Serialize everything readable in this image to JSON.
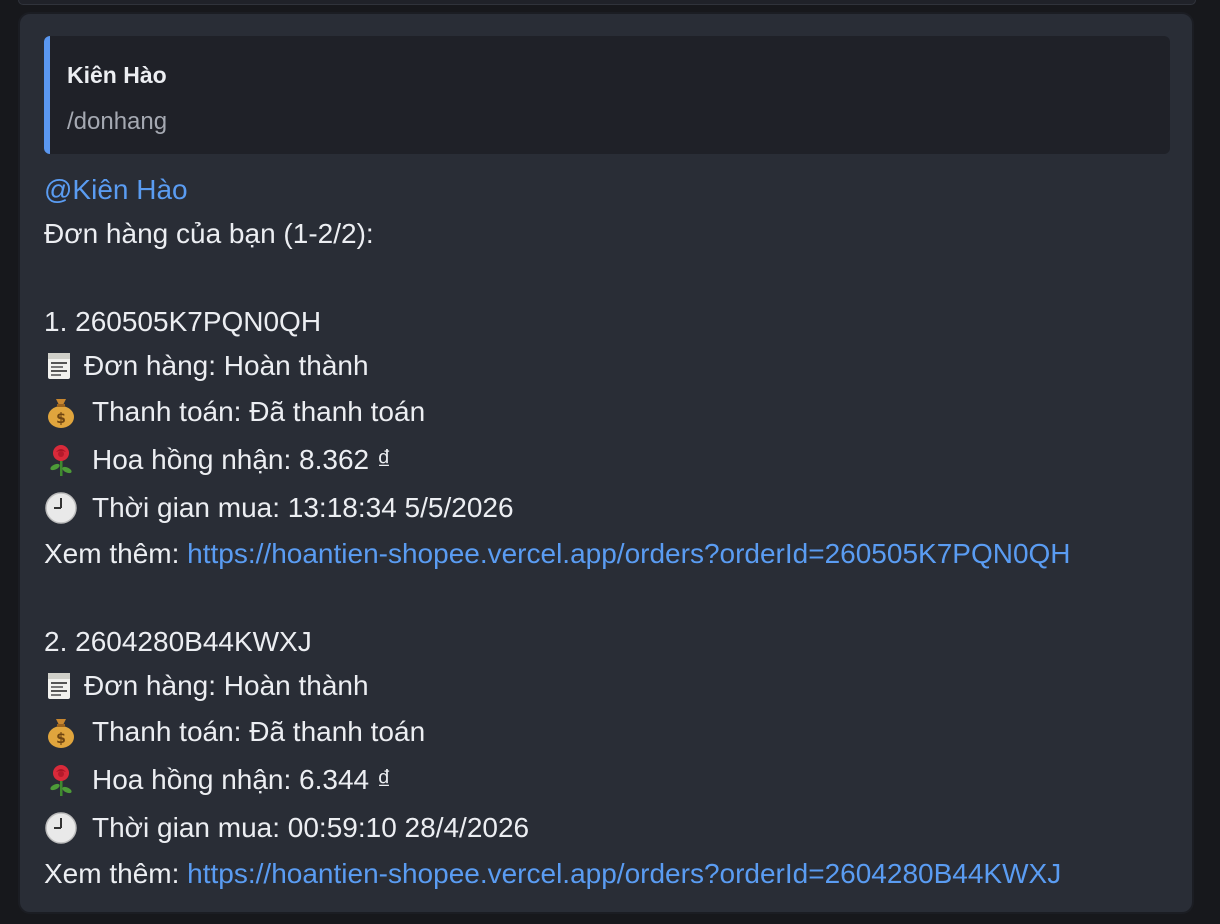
{
  "reply_quote": {
    "author": "Kiên Hào",
    "text": "/donhang"
  },
  "message": {
    "mention": "@Kiên Hào",
    "header": "Đơn hàng của bạn (1-2/2):",
    "orders": [
      {
        "title": "1. 260505K7PQN0QH",
        "status_line": "Đơn hàng: Hoàn thành",
        "payment_line": "Thanh toán: Đã thanh toán",
        "commission_line": "Hoa hồng nhận: 8.362 ₫",
        "time_line": "Thời gian mua: 13:18:34 5/5/2026",
        "more_label": "Xem thêm: ",
        "more_url": "https://hoantien-shopee.vercel.app/orders?orderId=260505K7PQN0QH"
      },
      {
        "title": "2. 2604280B44KWXJ",
        "status_line": "Đơn hàng: Hoàn thành",
        "payment_line": "Thanh toán: Đã thanh toán",
        "commission_line": "Hoa hồng nhận: 6.344 ₫",
        "time_line": "Thời gian mua: 00:59:10 28/4/2026",
        "more_label": "Xem thêm: ",
        "more_url": "https://hoantien-shopee.vercel.app/orders?orderId=2604280B44KWXJ"
      }
    ]
  },
  "icons": {
    "status": "receipt-icon",
    "payment": "money-bag-icon",
    "commission": "rose-icon",
    "time": "clock-icon"
  },
  "colors": {
    "background": "#17181c",
    "bubble": "#292d36",
    "quote_bg": "#1f2128",
    "quote_bar": "#5a97f0",
    "link": "#5a9cf2",
    "text": "#eceef2",
    "muted": "#a5a9b2"
  }
}
